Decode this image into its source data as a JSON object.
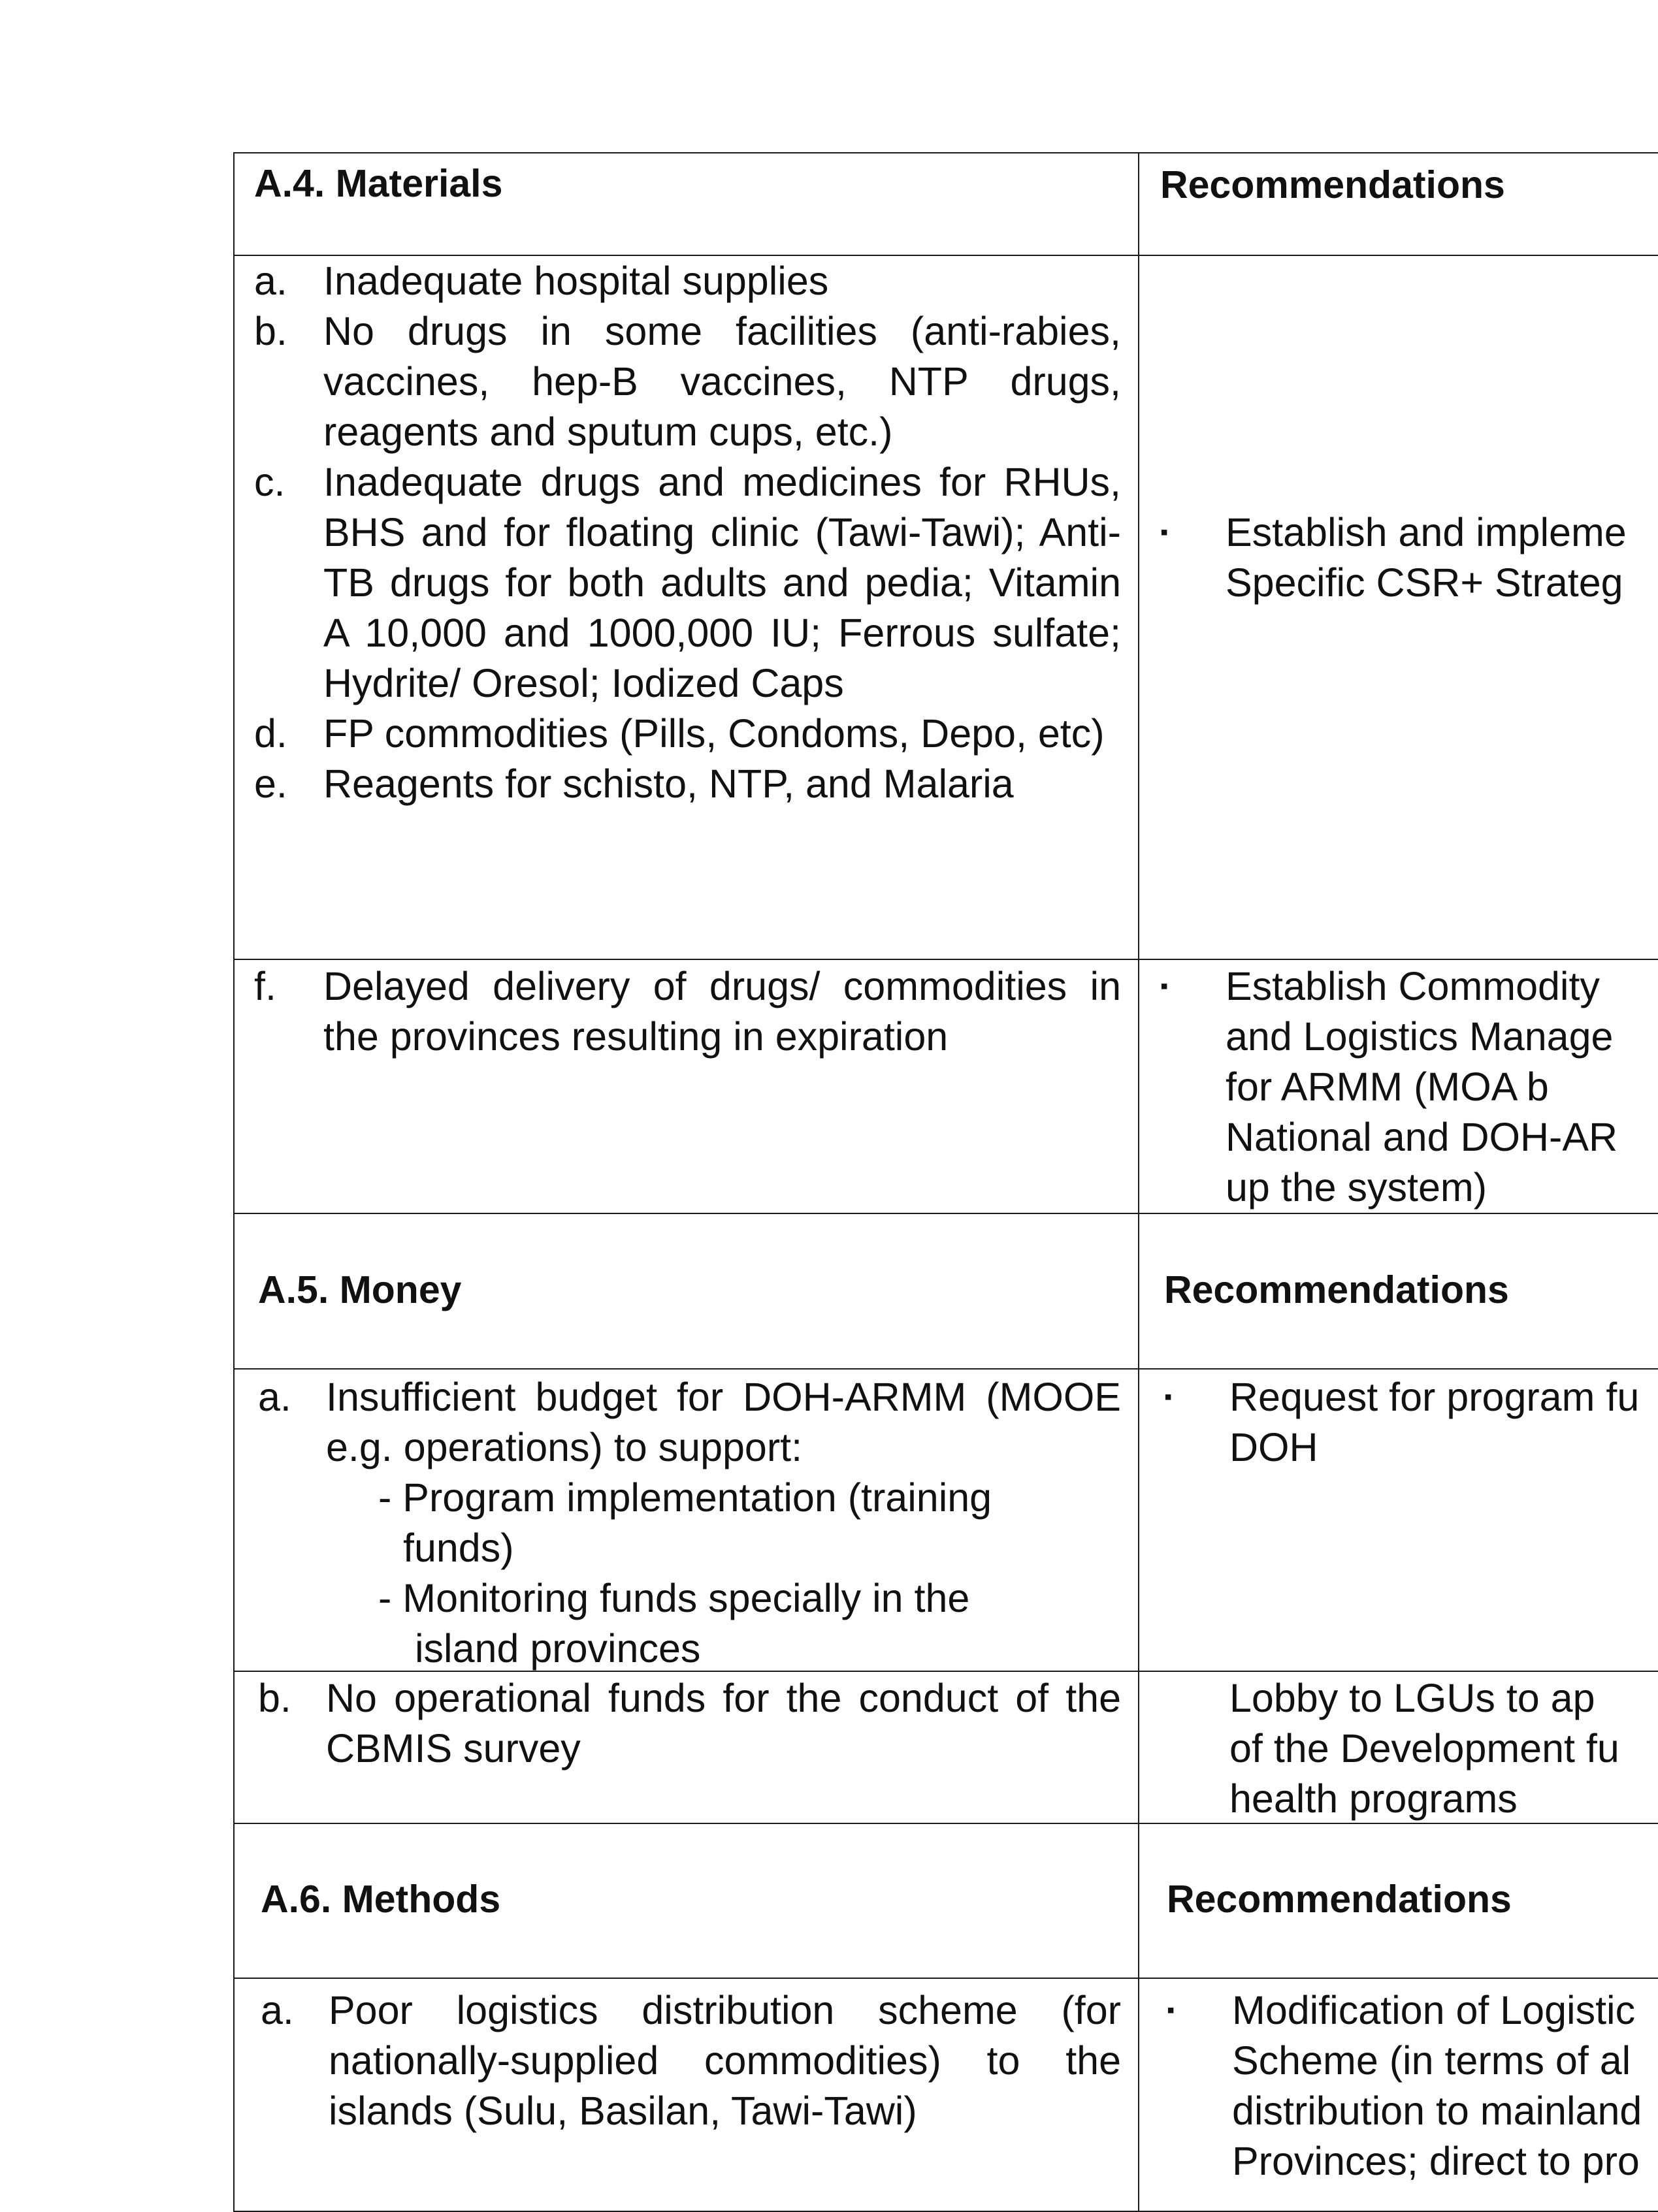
{
  "materials": {
    "header": "A.4. Materials",
    "rec_header": "Recommendations",
    "items": [
      {
        "marker": "a.",
        "text": "Inadequate hospital supplies"
      },
      {
        "marker": "b.",
        "text": "No drugs in some facilities (anti-rabies, vaccines, hep-B vaccines, NTP drugs, reagents and sputum cups, etc.)"
      },
      {
        "marker": "c.",
        "text": "Inadequate drugs and medicines for RHUs, BHS and for floating clinic (Tawi-Tawi); Anti-TB drugs for both adults and pedia; Vitamin A 10,000 and 1000,000 IU; Ferrous sulfate; Hydrite/ Oresol; Iodized Caps"
      },
      {
        "marker": "d.",
        "text": "FP commodities (Pills, Condoms, Depo, etc)"
      },
      {
        "marker": "e.",
        "text": "Reagents for schisto, NTP, and Malaria"
      }
    ],
    "rec1": [
      "Establish and impleme",
      "Specific CSR+ Strateg"
    ],
    "item_f": {
      "marker": "f.",
      "text": "Delayed delivery of drugs/ commodities in the provinces resulting in expiration"
    },
    "rec2": [
      "Establish Commodity",
      "and Logistics Manage",
      "for ARMM (MOA b",
      "National and DOH-AR",
      "up the system)"
    ]
  },
  "money": {
    "header": "A.5. Money",
    "rec_header": "Recommendations",
    "item_a": {
      "marker": "a.",
      "text": "Insufficient budget for DOH-ARMM (MOOE e.g. operations) to support:"
    },
    "sub1": [
      "- Program implementation (training",
      "funds)"
    ],
    "sub2": [
      "- Monitoring funds specially in the",
      "island provinces"
    ],
    "rec1": [
      "Request for program fu",
      "DOH"
    ],
    "item_b": {
      "marker": "b.",
      "text": "No operational funds for the conduct of the CBMIS survey"
    },
    "rec2": [
      "Lobby to LGUs to ap",
      "of the Development fu",
      "health programs"
    ]
  },
  "methods": {
    "header": "A.6. Methods",
    "rec_header": "Recommendations",
    "item_a": {
      "marker": "a.",
      "text": "Poor logistics distribution scheme (for nationally-supplied commodities) to the islands (Sulu, Basilan, Tawi-Tawi)"
    },
    "rec1": [
      "Modification of Logistic",
      "Scheme (in terms of al",
      "distribution to mainland",
      "Provinces; direct to pro"
    ]
  },
  "bullet_glyph": "▪"
}
